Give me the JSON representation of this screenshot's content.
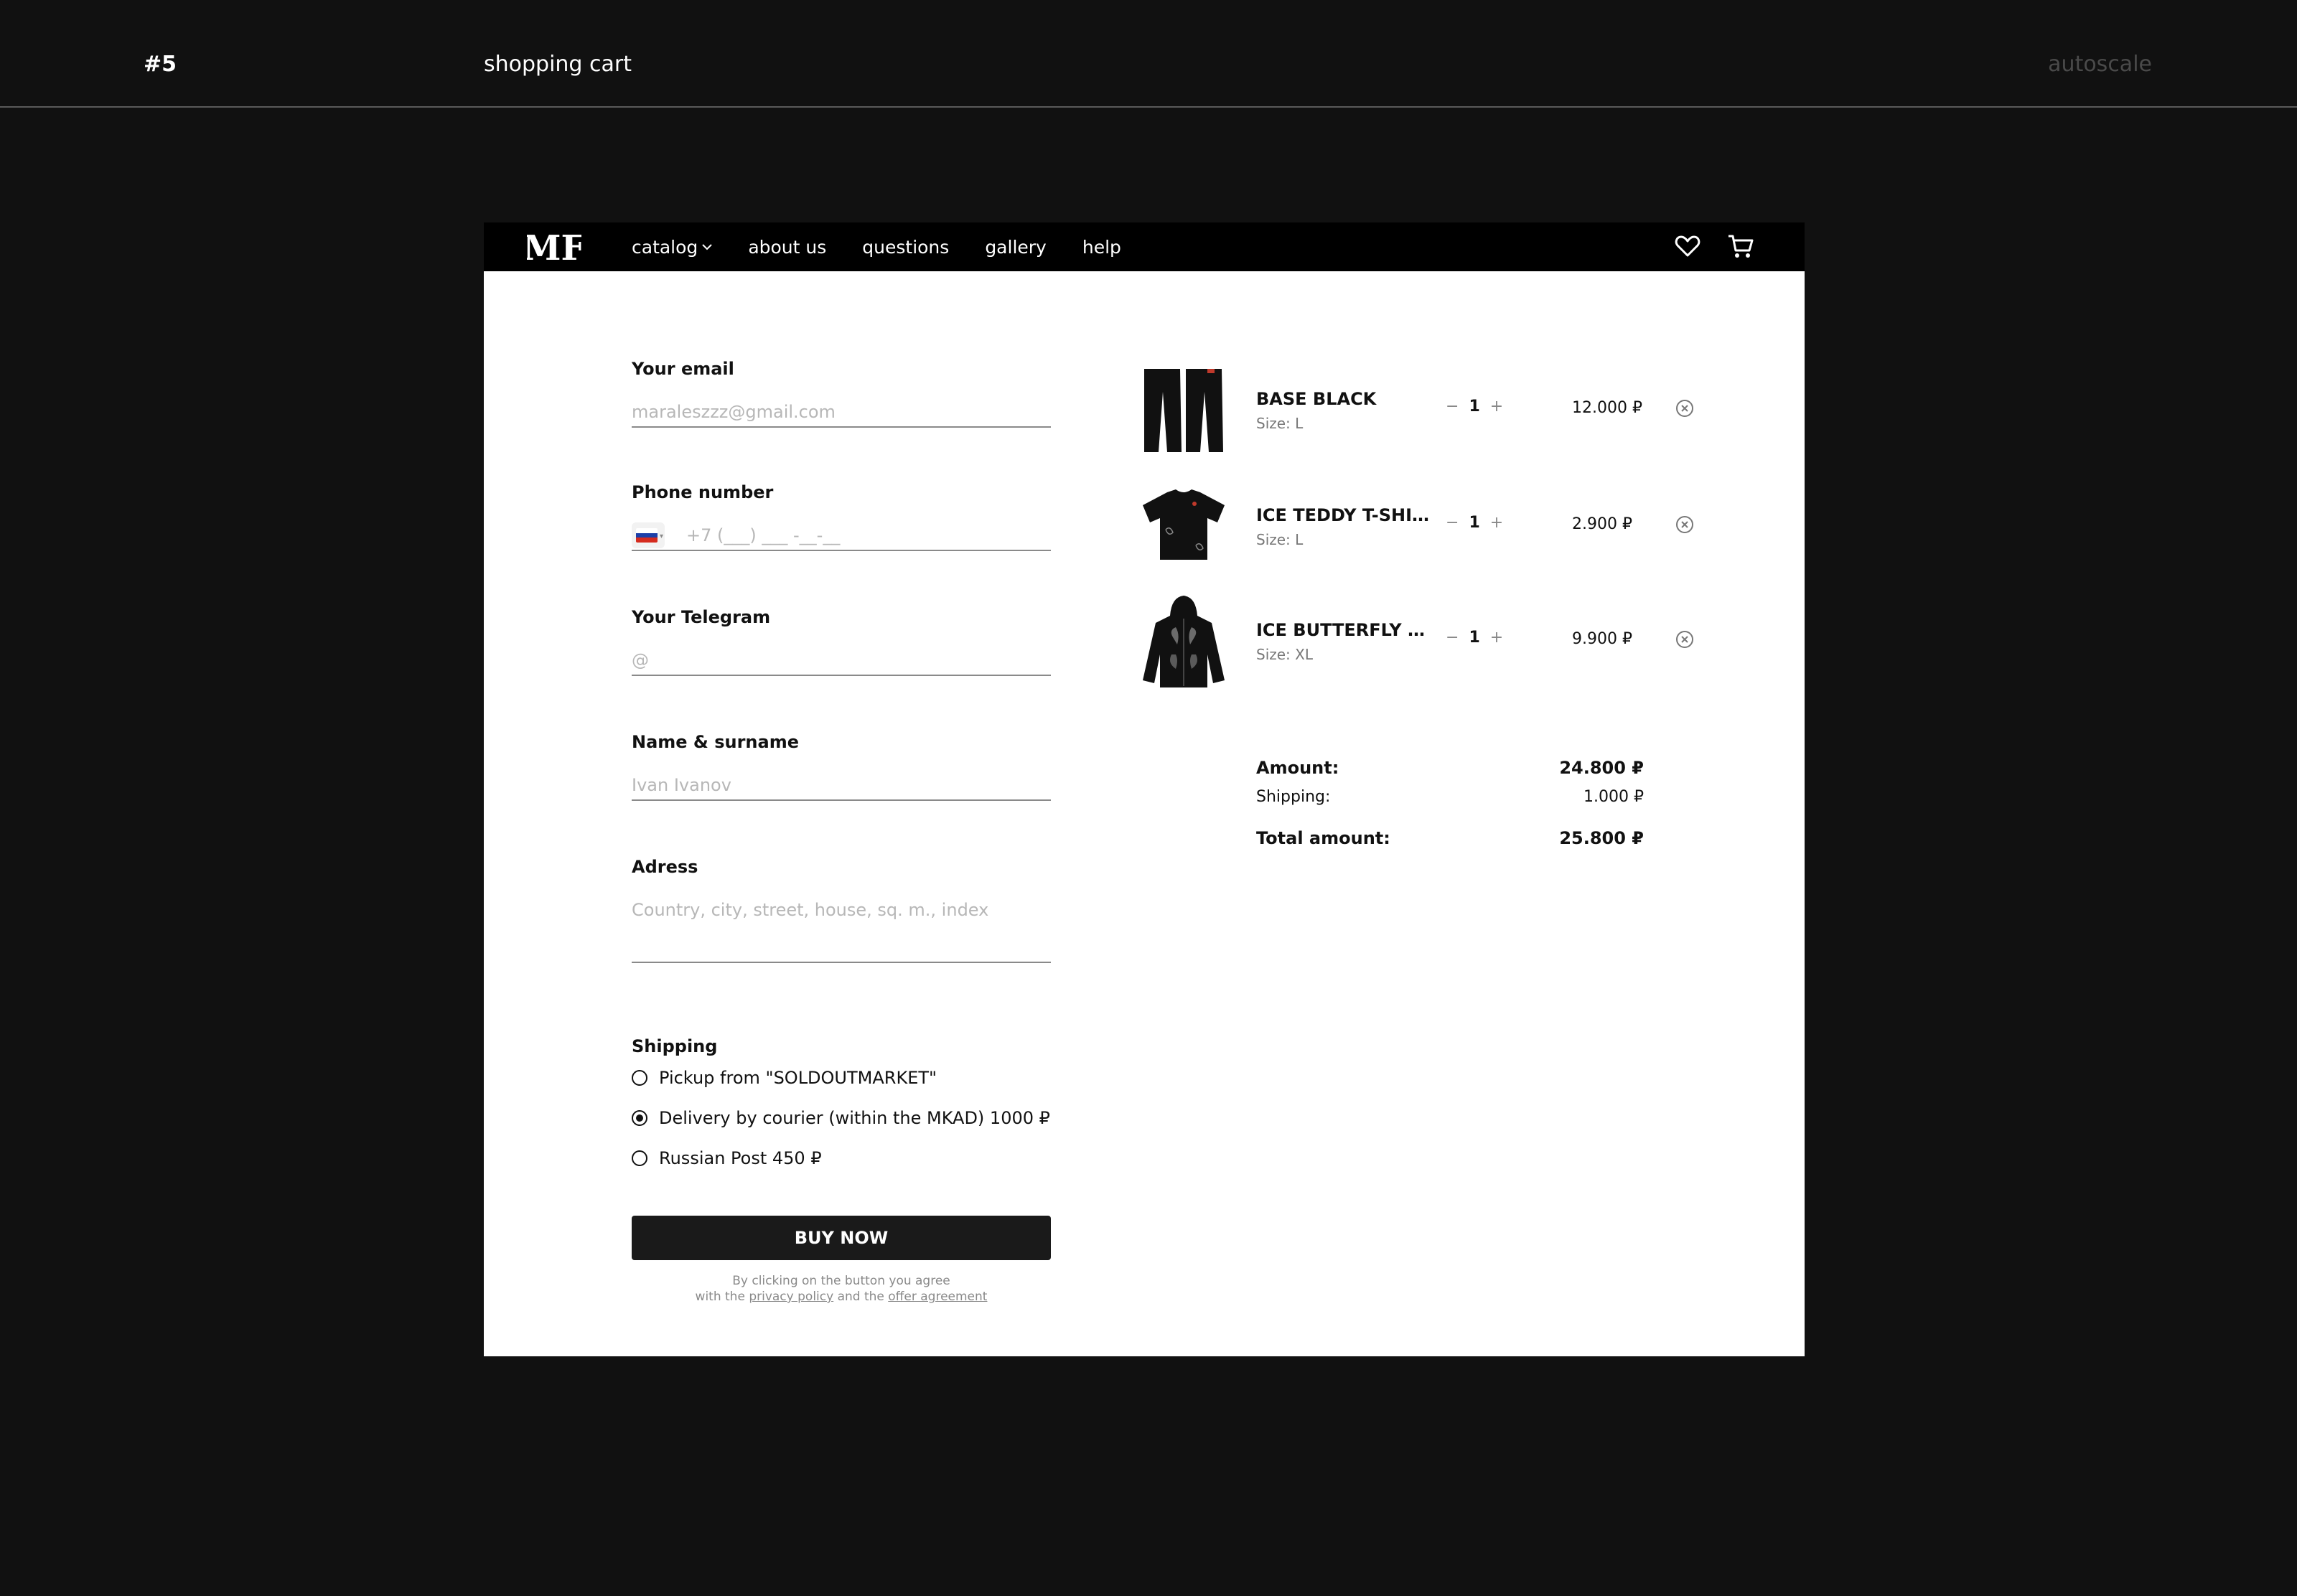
{
  "page": {
    "number": "#5",
    "title": "shopping cart",
    "tag": "autoscale"
  },
  "nav": {
    "logo": "MF",
    "links": [
      "catalog",
      "about us",
      "questions",
      "gallery",
      "help"
    ]
  },
  "form": {
    "email": {
      "label": "Your email",
      "placeholder": "maraleszzz@gmail.com"
    },
    "phone": {
      "label": "Phone number",
      "placeholder": "+7 (___) ___ -__-__",
      "country": "RU"
    },
    "telegram": {
      "label": "Your Telegram",
      "placeholder": "@"
    },
    "name": {
      "label": "Name & surname",
      "placeholder": "Ivan Ivanov"
    },
    "address": {
      "label": "Adress",
      "placeholder": "Country, city, street, house, sq. m., index"
    },
    "shipping": {
      "label": "Shipping",
      "options": [
        {
          "label": "Pickup from \"SOLDOUTMARKET\"",
          "selected": false
        },
        {
          "label": "Delivery by courier (within the MKAD) 1000 ₽",
          "selected": true
        },
        {
          "label": "Russian Post 450 ₽",
          "selected": false
        }
      ]
    },
    "buy_label": "BUY NOW",
    "agree": {
      "line1": "By clicking on the button you agree",
      "with": "with the",
      "privacy": "privacy policy",
      "and": "and the",
      "offer": "offer agreement"
    }
  },
  "cart": {
    "items": [
      {
        "name": "BASE BLACK",
        "size": "Size: L",
        "qty": "1",
        "price": "12.000 ₽",
        "thumb": "black-pants"
      },
      {
        "name": "ICE TEDDY T-SHIRT",
        "size": "Size: L",
        "qty": "1",
        "price": "2.900 ₽",
        "thumb": "black-tshirt"
      },
      {
        "name": "ICE BUTTERFLY I...",
        "size": "Size: XL",
        "qty": "1",
        "price": "9.900 ₽",
        "thumb": "black-hoodie"
      }
    ],
    "summary": {
      "amount_label": "Amount:",
      "amount": "24.800 ₽",
      "shipping_label": "Shipping:",
      "shipping": "1.000 ₽",
      "total_label": "Total amount:",
      "total": "25.800 ₽"
    }
  },
  "colors": {
    "page_bg": "#111111",
    "nav_bg": "#000000",
    "button_bg": "#1a1a1a",
    "placeholder": "#b7b7b7"
  }
}
